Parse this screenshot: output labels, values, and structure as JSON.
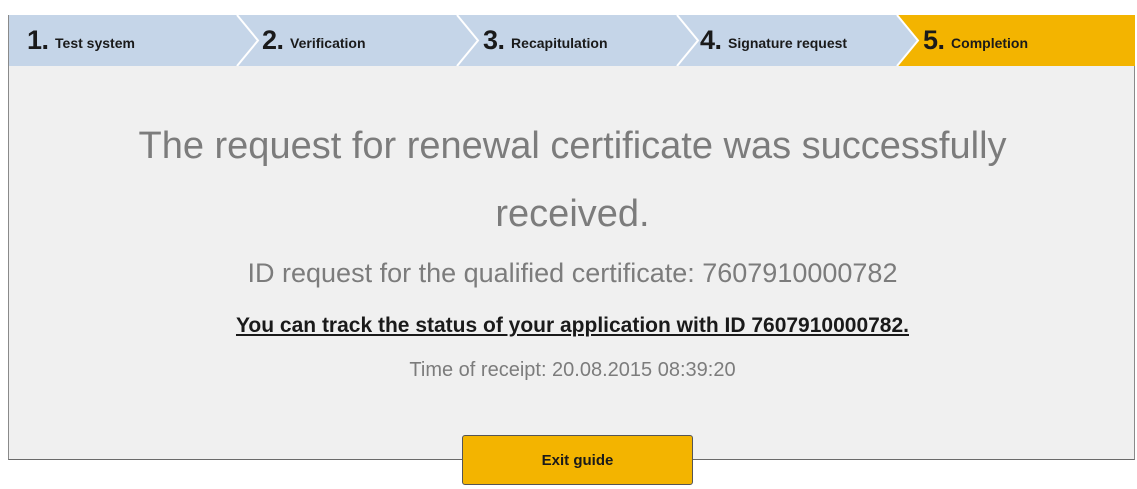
{
  "wizard": {
    "steps": [
      {
        "number": "1",
        "dot": ".",
        "label": "Test system",
        "state": "done"
      },
      {
        "number": "2",
        "dot": ".",
        "label": "Verification",
        "state": "done"
      },
      {
        "number": "3",
        "dot": ".",
        "label": "Recapitulation",
        "state": "done"
      },
      {
        "number": "4",
        "dot": ".",
        "label": "Signature request",
        "state": "done"
      },
      {
        "number": "5",
        "dot": ".",
        "label": "Completion",
        "state": "active"
      }
    ],
    "colors": {
      "done": "#c5d5e8",
      "active": "#f3b400",
      "separator": "#ffffff"
    }
  },
  "result": {
    "title_line1": "The request for renewal certificate was successfully",
    "title_line2": "received.",
    "id_line": "ID request for the qualified certificate: 7607910000782",
    "track_link": "You can track the status of your application with ID 7607910000782.",
    "time_line": "Time of receipt: 20.08.2015 08:39:20"
  },
  "actions": {
    "exit_label": "Exit guide"
  }
}
